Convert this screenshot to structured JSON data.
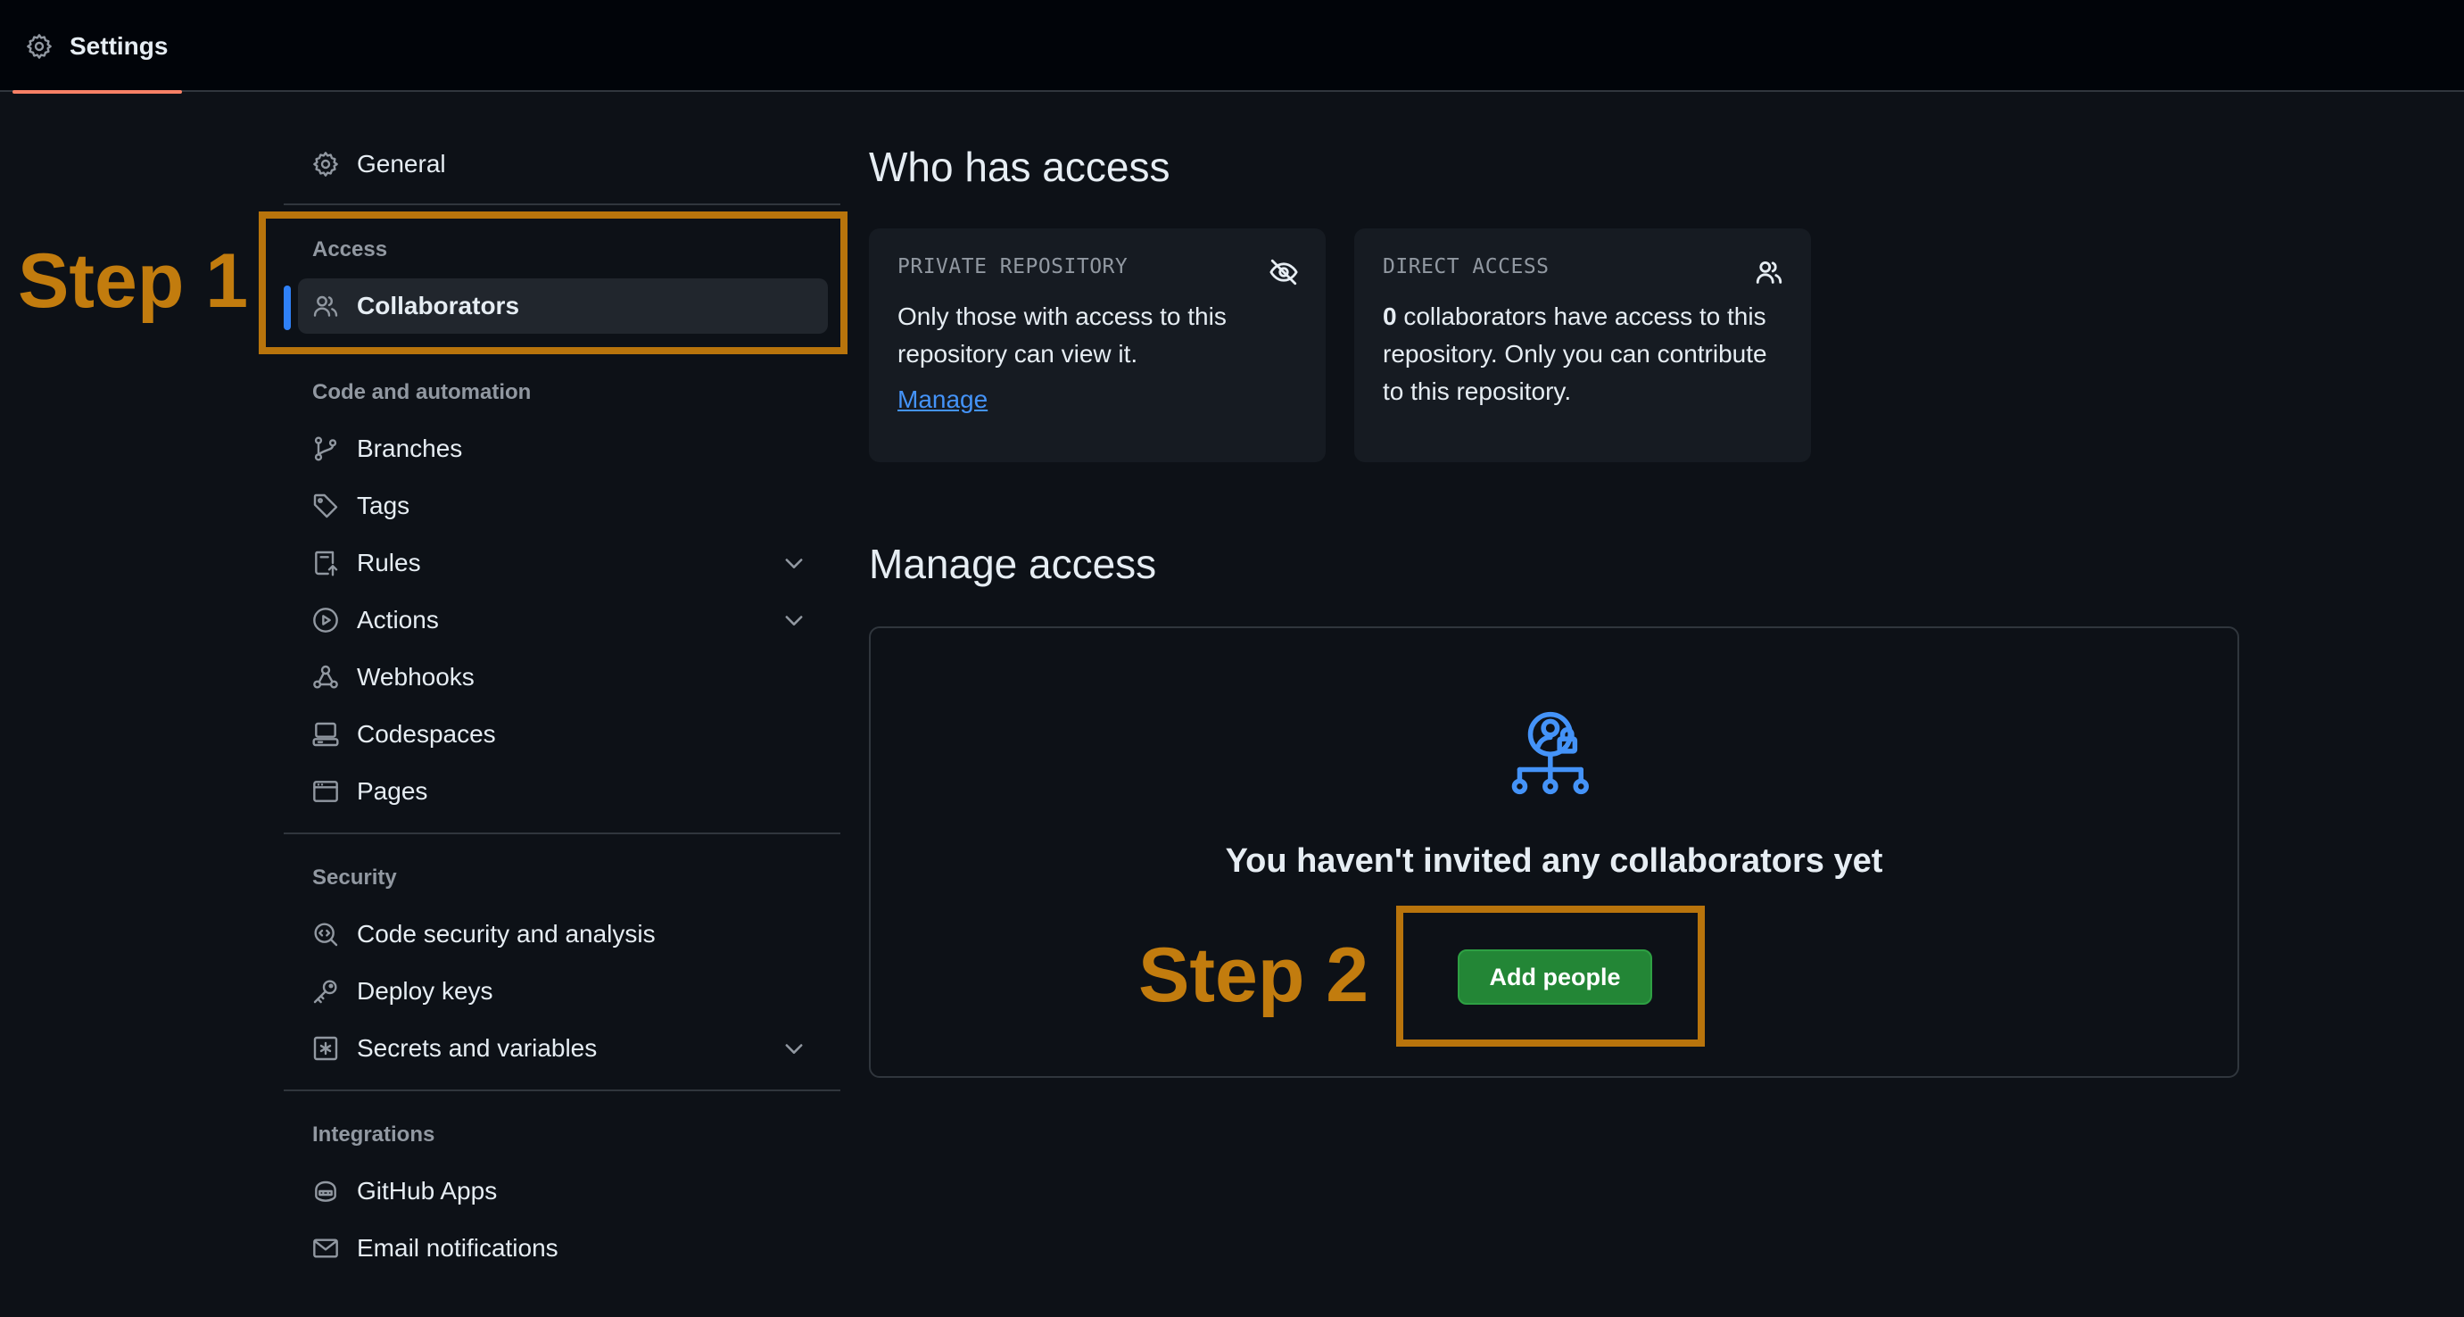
{
  "topbar": {
    "tab_label": "Settings",
    "tab_icon": "gear-icon"
  },
  "sidebar": {
    "general": "General",
    "sections": {
      "access": "Access",
      "code_automation": "Code and automation",
      "security": "Security",
      "integrations": "Integrations"
    },
    "items": {
      "collaborators": "Collaborators",
      "branches": "Branches",
      "tags": "Tags",
      "rules": "Rules",
      "actions": "Actions",
      "webhooks": "Webhooks",
      "codespaces": "Codespaces",
      "pages": "Pages",
      "code_security": "Code security and analysis",
      "deploy_keys": "Deploy keys",
      "secrets": "Secrets and variables",
      "github_apps": "GitHub Apps",
      "email_notifications": "Email notifications"
    }
  },
  "main": {
    "who_has_access_title": "Who has access",
    "private_card": {
      "heading": "PRIVATE REPOSITORY",
      "text": "Only those with access to this repository can view it.",
      "link": "Manage"
    },
    "direct_card": {
      "heading": "DIRECT ACCESS",
      "count": "0",
      "text": " collaborators have access to this repository. Only you can contribute to this repository."
    },
    "manage_access_title": "Manage access",
    "empty_title": "You haven't invited any collaborators yet",
    "add_button": "Add people"
  },
  "annotations": {
    "step1": "Step 1",
    "step2": "Step 2",
    "color": "#c27c0e"
  },
  "colors": {
    "accent": "#2f81f7",
    "link": "#4493f8",
    "button": "#238636",
    "tab_underline": "#f78166"
  }
}
